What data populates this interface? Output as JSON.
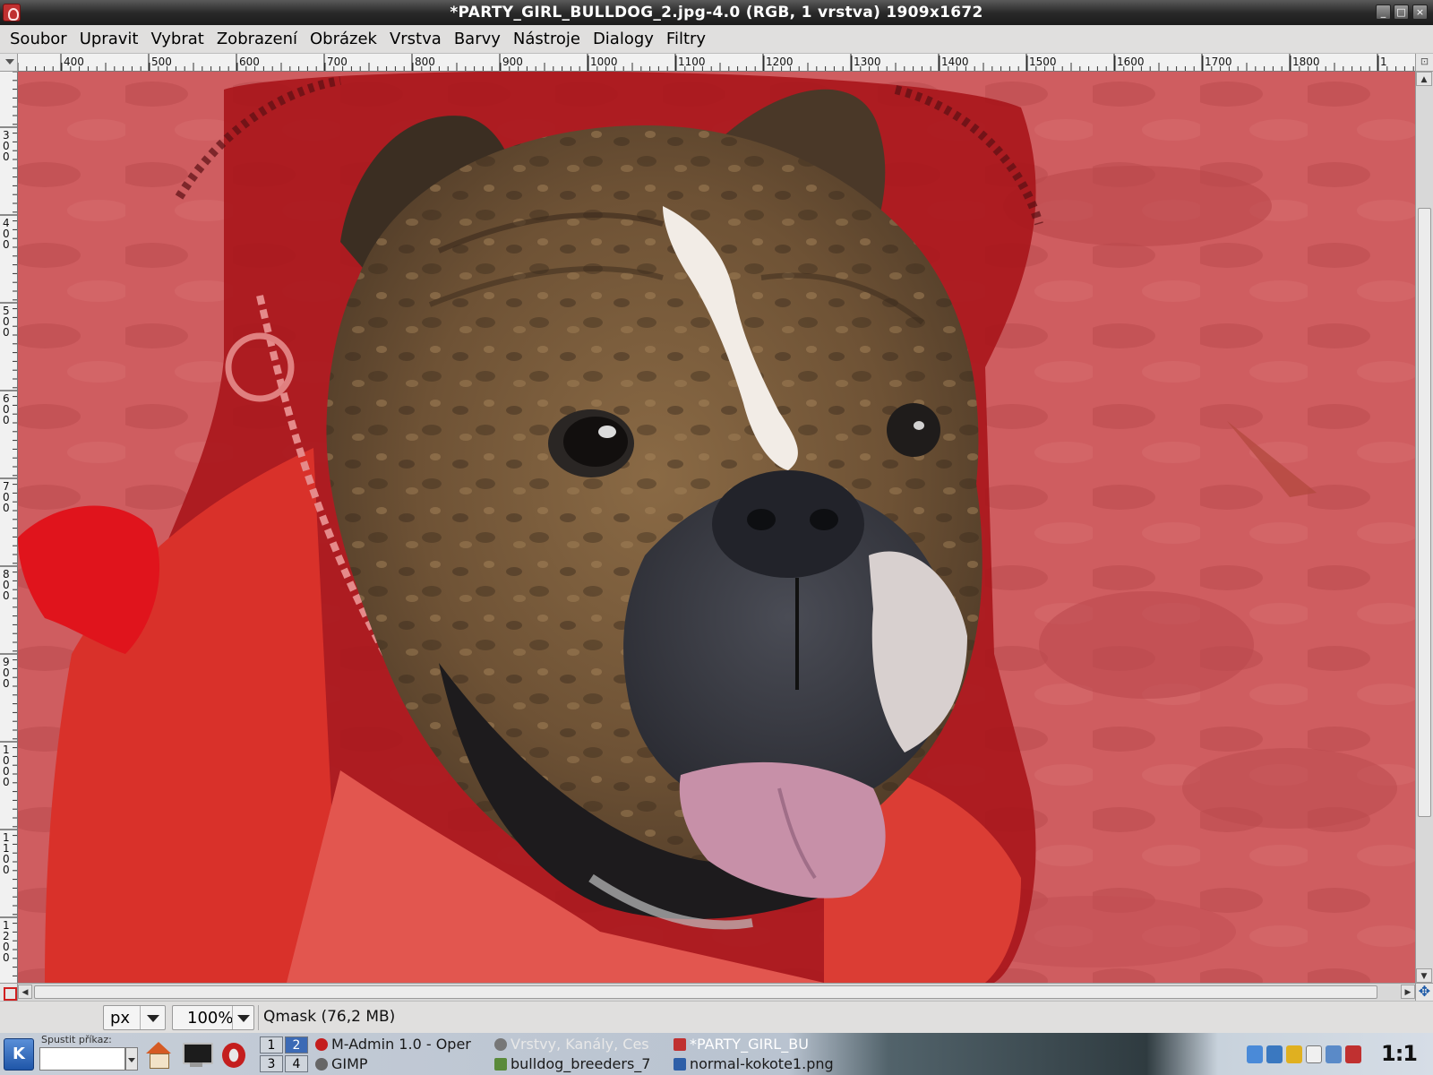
{
  "window": {
    "title": "*PARTY_GIRL_BULLDOG_2.jpg-4.0 (RGB, 1 vrstva) 1909x1672",
    "app_icon": "gimp-wilber-icon",
    "controls": [
      "minimize-icon",
      "maximize-icon",
      "close-icon"
    ]
  },
  "menu": [
    {
      "label": "Soubor"
    },
    {
      "label": "Upravit"
    },
    {
      "label": "Vybrat"
    },
    {
      "label": "Zobrazení"
    },
    {
      "label": "Obrázek"
    },
    {
      "label": "Vrstva"
    },
    {
      "label": "Barvy"
    },
    {
      "label": "Nástroje"
    },
    {
      "label": "Dialogy"
    },
    {
      "label": "Filtry"
    }
  ],
  "rulers": {
    "horizontal": [
      "400",
      "500",
      "600",
      "700",
      "800",
      "900",
      "1000",
      "1100",
      "1200",
      "1300",
      "1400",
      "1500",
      "1600",
      "1700",
      "1800",
      "1"
    ],
    "vertical": [
      "300",
      "400",
      "500",
      "600",
      "700",
      "800",
      "900",
      "1000",
      "1100",
      "1200"
    ]
  },
  "canvas": {
    "image_subject": "bulldog-face-photo",
    "quick_mask_color": "#d23c3c"
  },
  "statusbar": {
    "unit": "px",
    "zoom": "100%",
    "message": "Qmask (76,2 MB)"
  },
  "taskbar": {
    "command_label": "Spustit příkaz:",
    "command_value": "",
    "pager": [
      "1",
      "2",
      "3",
      "4"
    ],
    "active_desktop": "2",
    "tasks": [
      {
        "label": "M-Admin 1.0 - Oper",
        "icon": "opera-icon"
      },
      {
        "label": "Vrstvy, Kanály, Ces",
        "icon": "gimp-eye-icon"
      },
      {
        "label": "*PARTY_GIRL_BU",
        "icon": "gimp-wilber-icon"
      },
      {
        "label": "GIMP",
        "icon": "gimp-eye-icon"
      },
      {
        "label": "bulldog_breeders_7",
        "icon": "image-icon"
      },
      {
        "label": "normal-kokote1.png",
        "icon": "image-icon"
      }
    ],
    "tray": [
      "volume-icon",
      "network-icon",
      "klipper-icon",
      "kwallet-icon",
      "sync-icon",
      "gimp-tray-icon"
    ],
    "clock": "1:1"
  }
}
